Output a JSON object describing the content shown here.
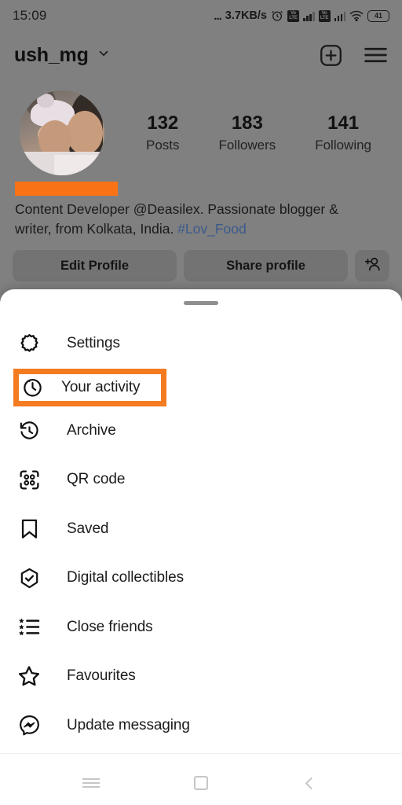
{
  "status_bar": {
    "time": "15:09",
    "dots": "...",
    "network_speed": "3.7KB/s",
    "alarm_icon": "alarm-icon",
    "sim1_label": "VoLTE",
    "sim2_label": "VoLTE",
    "wifi_icon": "wifi-icon",
    "battery_level": "41"
  },
  "app_bar": {
    "username": "ush_mg",
    "chevron_icon": "chevron-down-icon",
    "add_icon": "plus-box-icon",
    "menu_icon": "hamburger-menu-icon"
  },
  "profile": {
    "avatar_name": "profile-avatar",
    "stats": [
      {
        "count": "132",
        "label": "Posts"
      },
      {
        "count": "183",
        "label": "Followers"
      },
      {
        "count": "141",
        "label": "Following"
      }
    ],
    "redaction_color": "#F97316",
    "bio_line1": "Content Developer @Deasilex. Passionate blogger &",
    "bio_line2": "writer, from Kolkata, India. ",
    "bio_hashtag": "#Lov_Food",
    "hashtag_color": "#3A5A8C",
    "buttons": {
      "edit_profile": "Edit Profile",
      "share_profile": "Share profile",
      "add_person_icon": "add-person-icon"
    }
  },
  "sheet": {
    "grabber": "drag-handle",
    "highlight_color": "#F47B20",
    "highlighted_item": "Your activity",
    "items": [
      {
        "icon": "settings-gear-icon",
        "label": "Settings",
        "highlighted": false
      },
      {
        "icon": "clock-activity-icon",
        "label": "Your activity",
        "highlighted": true
      },
      {
        "icon": "archive-clock-icon",
        "label": "Archive",
        "highlighted": false
      },
      {
        "icon": "qr-code-icon",
        "label": "QR code",
        "highlighted": false
      },
      {
        "icon": "bookmark-icon",
        "label": "Saved",
        "highlighted": false
      },
      {
        "icon": "shield-check-icon",
        "label": "Digital collectibles",
        "highlighted": false
      },
      {
        "icon": "star-list-icon",
        "label": "Close friends",
        "highlighted": false
      },
      {
        "icon": "star-icon",
        "label": "Favourites",
        "highlighted": false
      },
      {
        "icon": "messenger-icon",
        "label": "Update messaging",
        "highlighted": false
      }
    ]
  },
  "nav_bar": {
    "recents_icon": "recents-icon",
    "home_icon": "home-square-icon",
    "back_icon": "back-chevron-icon"
  }
}
